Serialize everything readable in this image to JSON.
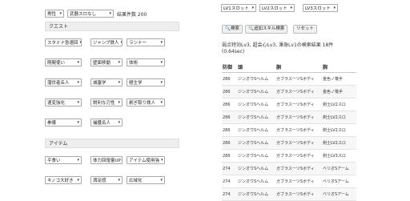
{
  "top": {
    "gender": "男性",
    "weapon_slot": "武器スロなし",
    "result_count": "結果件数 200"
  },
  "quest": {
    "title": "クエスト",
    "rows": [
      [
        "スタミナ急速回",
        "ジャンプ鉄人",
        "ランナー"
      ],
      [
        "剛腕使い",
        "壁面移動",
        "体術"
      ],
      [
        "潜伏者名人",
        "城塞学",
        "極生学"
      ],
      [
        "速変強化",
        "鋭利な刃性",
        "剥ぎ取り鉄人"
      ],
      [
        "拳護",
        "捕獲名人"
      ]
    ]
  },
  "item": {
    "title": "アイテム",
    "rows": [
      [
        "平食い",
        "体力回復量UP",
        "アイテム使用強"
      ],
      [
        "キノコ大好き",
        "満足感",
        "広域化"
      ]
    ]
  },
  "right": {
    "slots": [
      "LV1スロット",
      "LV2スロット",
      "LV3スロット"
    ],
    "search_btn": "検索",
    "add_skill_btn": "追加スキル検索",
    "reset_btn": "リセット",
    "result_line1": "弱点特効Lv3, 超会心Lv3, 渾身Lv1の検索結果 18件",
    "result_line2": "(0.64sec)"
  },
  "table": {
    "headers": [
      "防御",
      "頭",
      "胴",
      "腕"
    ],
    "rows": [
      [
        "286",
        "ジンオウSヘルム",
        "ガブラスーツSボディ",
        "金色ノ篭手"
      ],
      [
        "286",
        "ジンオウSヘルム",
        "ガブラスーツSボディ",
        "金色ノ篭手"
      ],
      [
        "286",
        "ジンオウSヘルム",
        "ガブラスーツSボディ",
        "剣士LV2スロ"
      ],
      [
        "286",
        "ジンオウSヘルム",
        "ガブラスーツSボディ",
        "剣士LV2スロ"
      ],
      [
        "286",
        "ジンオウSヘルム",
        "ガブラスーツSボディ",
        "剣士LV2スロ"
      ],
      [
        "286",
        "ジンオウSヘルム",
        "ガブラスーツSボディ",
        "剣士LV2スロ"
      ],
      [
        "286",
        "ジンオウSヘルム",
        "ガブラスーツSボディ",
        "剣士LV3スロ"
      ],
      [
        "274",
        "ジンオウSヘルム",
        "ガブラスーツSボディ",
        "ベリオSアーム"
      ],
      [
        "274",
        "ジンオウSヘルム",
        "ガブラスーツSボディ",
        "ベリオSアーム"
      ],
      [
        "274",
        "ジンオウSヘルム",
        "ガブラスーツSボディ",
        "ベリオSアーム"
      ]
    ]
  }
}
